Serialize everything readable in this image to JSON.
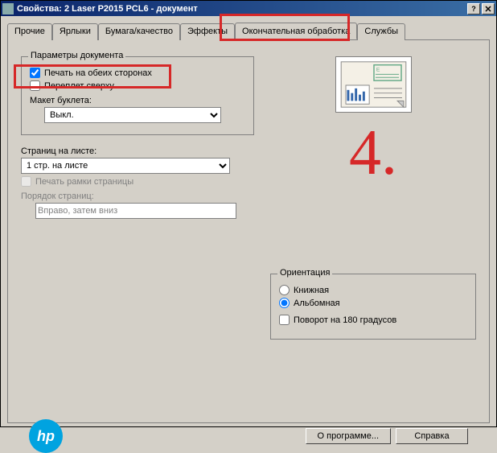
{
  "window": {
    "title": "Свойства: 2 Laser P2015 PCL6 - документ"
  },
  "tabs": {
    "list": [
      {
        "label": "Прочие"
      },
      {
        "label": "Ярлыки"
      },
      {
        "label": "Бумага/качество"
      },
      {
        "label": "Эффекты"
      },
      {
        "label": "Окончательная обработка"
      },
      {
        "label": "Службы"
      }
    ],
    "active_index": 4
  },
  "doc_params": {
    "legend": "Параметры документа",
    "print_both_label": "Печать на обеих сторонах",
    "print_both_checked": true,
    "bind_top_label": "Переплет сверху",
    "bind_top_checked": false,
    "booklet_label": "Макет буклета:",
    "booklet_value": "Выкл."
  },
  "pages_per_sheet": {
    "label": "Страниц на листе:",
    "value": "1 стр. на листе",
    "print_borders_label": "Печать рамки страницы",
    "print_borders_checked": false,
    "page_order_label": "Порядок страниц:",
    "page_order_value": "Вправо, затем вниз"
  },
  "orientation": {
    "legend": "Ориентация",
    "portrait_label": "Книжная",
    "landscape_label": "Альбомная",
    "selected": "landscape",
    "rotate_label": "Поворот на 180 градусов",
    "rotate_checked": false
  },
  "footer": {
    "about_label": "О программе...",
    "help_label": "Справка"
  },
  "annotation": {
    "big_number": "4."
  },
  "logo_text": "hp"
}
